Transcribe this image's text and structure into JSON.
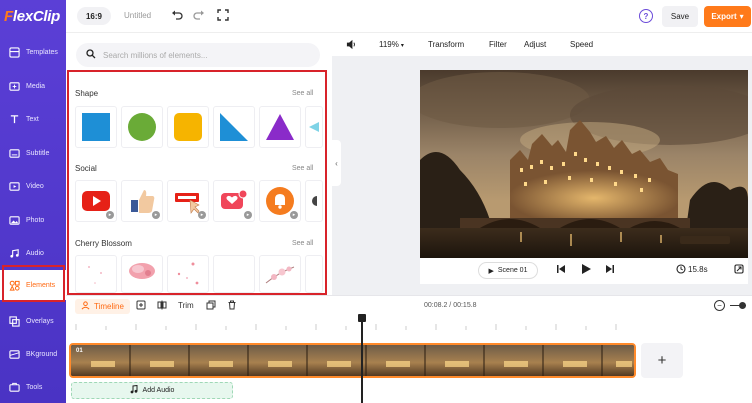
{
  "app": {
    "logo_text": "FlexClip",
    "logo_first": "F",
    "logo_rest": "lexClip"
  },
  "sidebar": {
    "items": [
      {
        "label": "Templates",
        "icon": "templates-icon"
      },
      {
        "label": "Media",
        "icon": "media-icon"
      },
      {
        "label": "Text",
        "icon": "text-icon"
      },
      {
        "label": "Subtitle",
        "icon": "subtitle-icon"
      },
      {
        "label": "Video",
        "icon": "video-icon"
      },
      {
        "label": "Photo",
        "icon": "photo-icon"
      },
      {
        "label": "Audio",
        "icon": "audio-icon"
      },
      {
        "label": "Elements",
        "icon": "elements-icon",
        "active": true
      },
      {
        "label": "Overlays",
        "icon": "overlays-icon"
      },
      {
        "label": "BKground",
        "icon": "background-icon"
      },
      {
        "label": "Tools",
        "icon": "tools-icon"
      }
    ]
  },
  "topbar": {
    "ratio": "16:9",
    "title": "Untitled",
    "help": "?",
    "save_label": "Save",
    "export_label": "Export",
    "export_chevron": "▾"
  },
  "panel": {
    "search_placeholder": "Search millions of elements...",
    "sections": [
      {
        "title": "Shape",
        "see_all": "See all"
      },
      {
        "title": "Social",
        "see_all": "See all"
      },
      {
        "title": "Cherry Blossom",
        "see_all": "See all"
      }
    ]
  },
  "editor": {
    "zoom": "119%",
    "zoom_chevron": "▾",
    "tools": [
      "Transform",
      "Filter",
      "Adjust",
      "Speed"
    ],
    "scene_label": "Scene 01",
    "duration": "15.8s"
  },
  "timeline": {
    "tab_label": "Timeline",
    "trim_label": "Trim",
    "time": "00:08.2 / 00:15.8",
    "clip_number": "01",
    "add_audio_label": "Add Audio",
    "add_clip_symbol": "+",
    "zoom_minus_symbol": "−"
  },
  "colors": {
    "sidebar": "#5b3fd6",
    "accent": "#ff7a1a",
    "highlight": "#d8232a",
    "shape_blue": "#1e8fd6",
    "shape_green": "#6aab37",
    "shape_yellow": "#f6b400",
    "shape_purple": "#8a2bc9"
  }
}
